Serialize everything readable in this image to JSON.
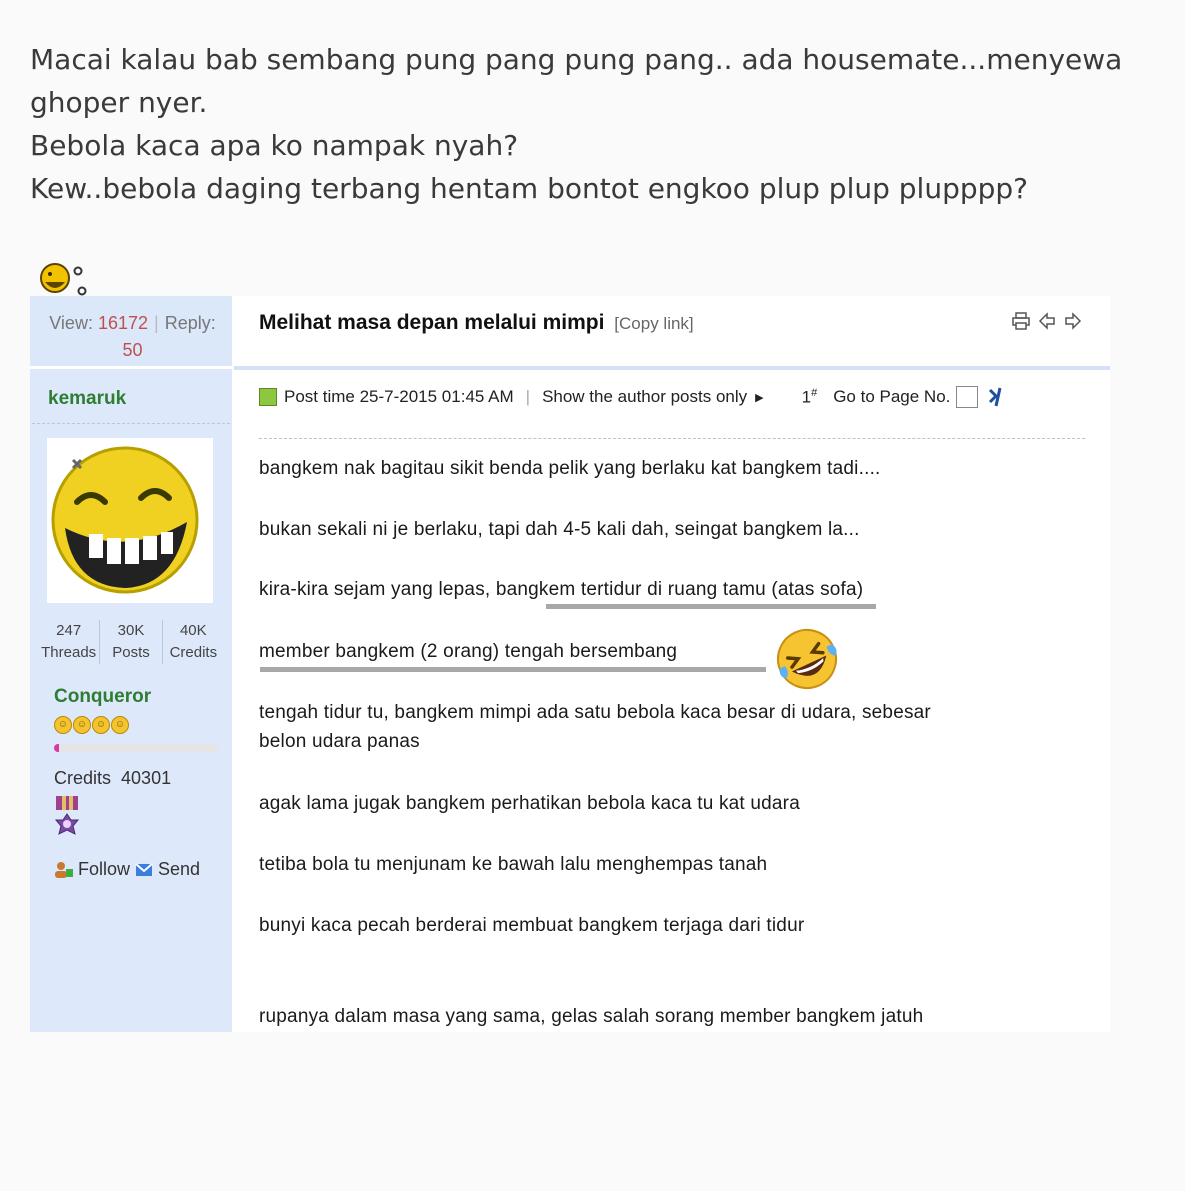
{
  "caption": {
    "lines": [
      "Macai kalau bab sembang pung pang pung pang.. ada housemate...menyewa",
      "ghoper nyer.",
      "Bebola kaca apa ko nampak nyah?",
      "Kew..bebola daging terbang hentam bontot engkoo plup plup plupppp?"
    ]
  },
  "forum": {
    "view_label": "View:",
    "views": "16172",
    "reply_label": "Reply:",
    "replies": "50",
    "title": "Melihat masa depan melalui mimpi",
    "copy_link": "[Copy link]",
    "author": {
      "name": "kemaruk",
      "threads": "247",
      "threads_label": "Threads",
      "posts": "30K",
      "posts_label": "Posts",
      "credits_short": "40K",
      "credits_label": "Credits",
      "rank": "Conqueror",
      "rank_progress": 0.03,
      "credits_line_label": "Credits",
      "credits_value": "40301",
      "follow": "Follow",
      "send": "Send"
    },
    "meta": {
      "post_time": "Post time 25-7-2015 01:45 AM",
      "show_author": "Show the author posts only",
      "floor": "1",
      "floor_mark": "#",
      "goto": "Go to Page No."
    },
    "paragraphs": [
      "bangkem nak bagitau sikit benda pelik yang berlaku kat bangkem tadi....",
      "bukan sekali ni je berlaku, tapi dah 4-5 kali dah, seingat bangkem la...",
      "kira-kira sejam yang lepas, bangkem tertidur di ruang tamu (atas sofa)",
      "member bangkem (2 orang) tengah bersembang",
      "tengah tidur tu, bangkem mimpi ada satu bebola kaca besar di udara, sebesar",
      "belon udara panas",
      "agak lama jugak bangkem perhatikan bebola kaca tu kat udara",
      "tetiba bola tu menjunam ke bawah lalu menghempas tanah",
      "bunyi kaca pecah berderai membuat bangkem terjaga dari tidur",
      "rupanya dalam masa yang sama, gelas salah sorang member bangkem jatuh"
    ]
  },
  "icons": [
    "shocked-face-icon",
    "grinning-avatar",
    "rank-star-icon",
    "medal-icon",
    "follow-icon",
    "mail-icon",
    "print-icon",
    "prev-thread-icon",
    "next-thread-icon",
    "post-icon",
    "jump-icon",
    "rolling-laughing-emoji"
  ]
}
